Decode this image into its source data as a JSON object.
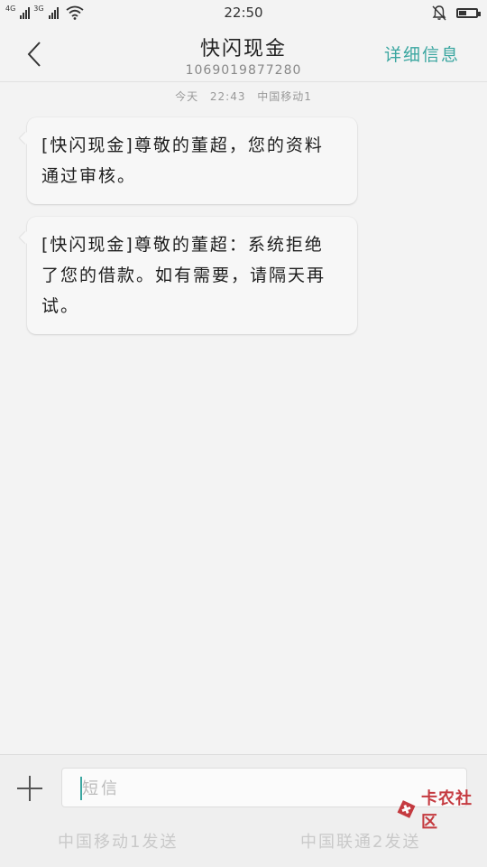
{
  "status_bar": {
    "sim1_tag": "4G",
    "sim2_tag": "3G",
    "time": "22:50",
    "battery_level": 0.45
  },
  "header": {
    "title": "快闪现金",
    "number": "1069019877280",
    "detail_label": "详细信息"
  },
  "conversation": {
    "date_line": "今天 22:43 中国移动1",
    "messages": [
      {
        "text": "[快闪现金]尊敬的董超，您的资料通过审核。"
      },
      {
        "text": "[快闪现金]尊敬的董超：系统拒绝了您的借款。如有需要，请隔天再试。"
      }
    ]
  },
  "composer": {
    "placeholder": "短信",
    "send_sim1": "中国移动1发送",
    "send_sim2": "中国联通2发送"
  },
  "watermark": {
    "text": "卡农社区"
  },
  "colors": {
    "accent": "#3aa6a0",
    "watermark": "#c0272d"
  }
}
